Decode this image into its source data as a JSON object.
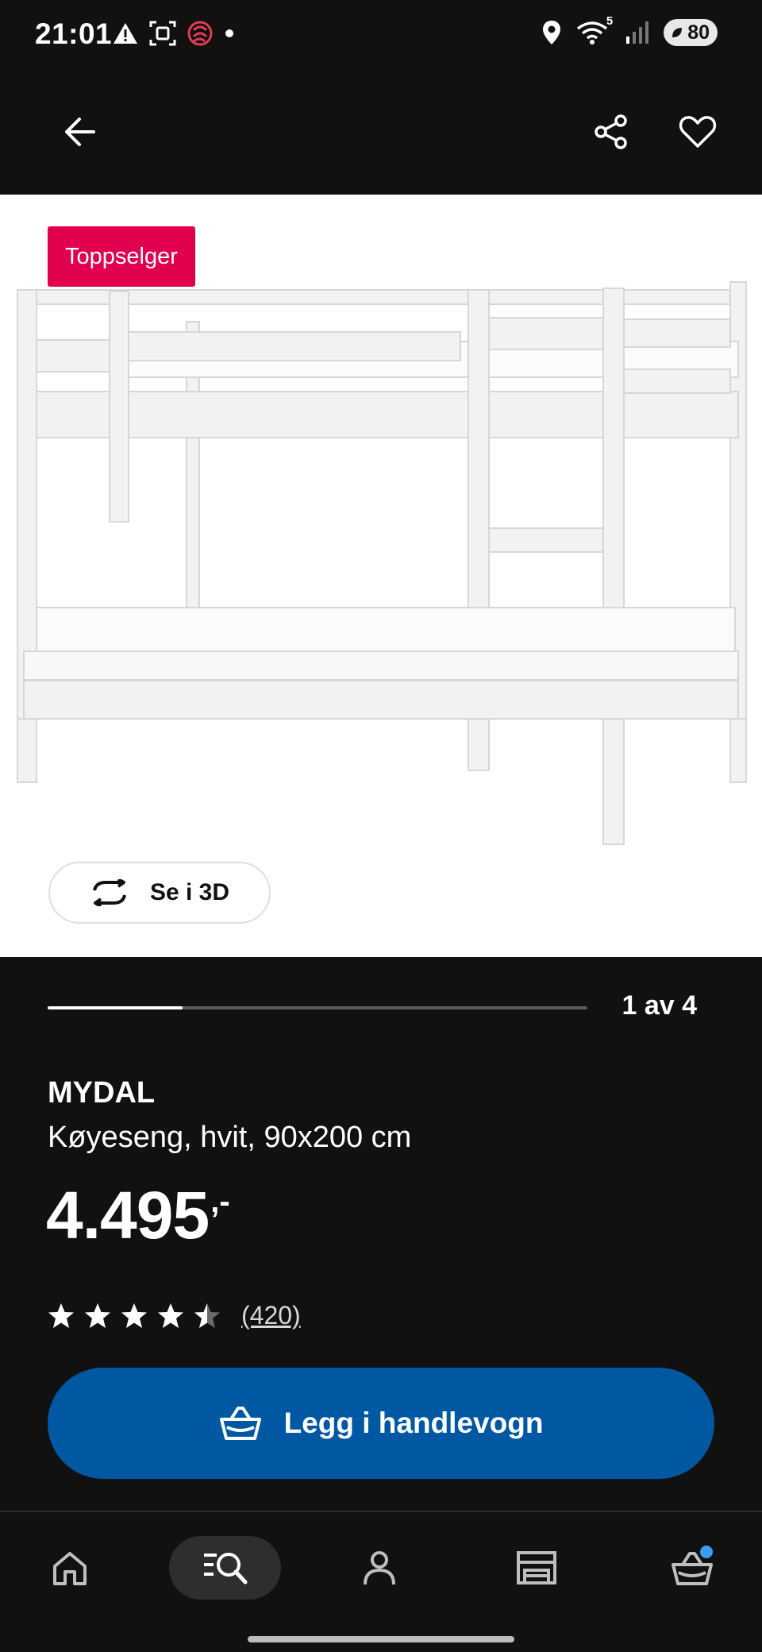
{
  "status_bar": {
    "time": "21:01",
    "left_icons": [
      "alert-triangle-icon",
      "screenshot-icon",
      "app-logo-icon",
      "dot-icon"
    ],
    "right_icons": [
      "location-icon",
      "wifi-icon",
      "signal-icon"
    ],
    "wifi_badge": "5",
    "battery": "80"
  },
  "app_bar": {
    "back_icon": "arrow-left-icon",
    "share_icon": "share-icon",
    "favorite_icon": "heart-icon"
  },
  "gallery": {
    "badge": "Toppselger",
    "view_3d_label": "Se i 3D",
    "page_counter": "1 av 4",
    "progress_fraction": 0.25
  },
  "product": {
    "name": "MYDAL",
    "description": "Køyeseng, hvit, 90x200 cm",
    "price": "4.495",
    "price_suffix": ",-",
    "rating_value": 4.5,
    "rating_max": 5,
    "review_count": "(420)"
  },
  "cart_button": {
    "label": "Legg i handlevogn"
  },
  "bottom_nav": {
    "items": [
      "home-icon",
      "search-icon",
      "profile-icon",
      "store-icon",
      "cart-icon"
    ],
    "active_index": 1
  },
  "colors": {
    "background": "#111111",
    "badge": "#e0004d",
    "primary_button": "#0058a3",
    "cart_dot": "#3b9cff"
  }
}
